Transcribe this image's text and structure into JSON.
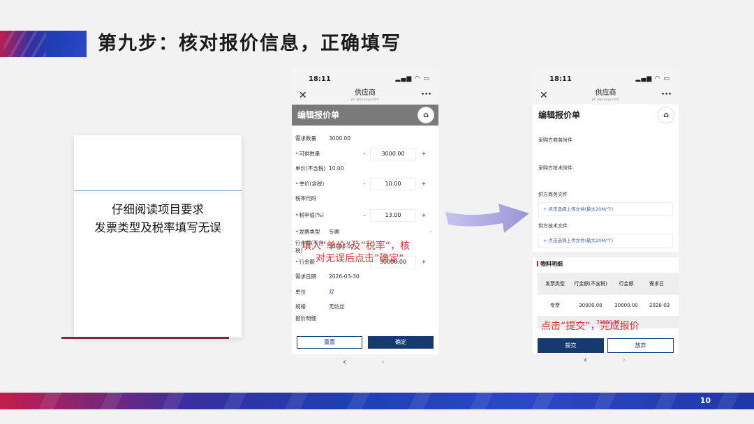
{
  "slide": {
    "title": "第九步：核对报价信息，正确填写",
    "note_lines": [
      "仔细阅读项目要求",
      "发票类型及税率填写无误"
    ],
    "annotation_left": [
      "填入”单价“及”税率“，核",
      "对无误后点击”确定“"
    ],
    "annotation_right": "点击“提交”，完成报价",
    "page_number": "10"
  },
  "phone_left": {
    "time": "18:11",
    "close": "✕",
    "title": "供应商",
    "url": "pc.wycxyyj.com",
    "more": "···",
    "header": "编辑报价单",
    "rows": [
      {
        "label": "需求数量",
        "value": "3000.00",
        "required": false
      },
      {
        "label": "可供数量",
        "value": "",
        "required": true,
        "stepper": "3000.00"
      },
      {
        "label": "单价(不含税)",
        "value": "10.00",
        "required": false
      },
      {
        "label": "单价(含税)",
        "value": "",
        "required": true,
        "stepper": "10.00"
      },
      {
        "label": "税率代码",
        "value": "",
        "required": false
      },
      {
        "label": "税率值(%)",
        "value": "",
        "required": true,
        "stepper": "13.00"
      },
      {
        "label": "发票类型",
        "value": "专票",
        "required": true
      },
      {
        "label": "行金额(不含税)",
        "value": "30000.00",
        "required": false
      },
      {
        "label": "行金额",
        "value": "",
        "required": true,
        "stepper": "30000.00"
      },
      {
        "label": "需求日期",
        "value": "2026-03-30",
        "required": false
      },
      {
        "label": "单位",
        "value": "双",
        "required": false
      },
      {
        "label": "规格",
        "value": "无纺丝",
        "required": false
      },
      {
        "label": "报价明细",
        "value": "",
        "required": false
      }
    ],
    "stepper_minus": "-",
    "stepper_plus": "+",
    "reset_label": "重置",
    "confirm_label": "确定",
    "back": "‹",
    "forward": "›"
  },
  "phone_right": {
    "time": "18:11",
    "close": "✕",
    "title": "供应商",
    "url": "pc.wycxyyj.com",
    "more": "···",
    "header": "编辑报价单",
    "buyer_business_files": "采购方商务附件",
    "buyer_tech_files": "采购方技术附件",
    "supplier_business_files": "供方商务文件",
    "supplier_tech_files": "供方技术文件",
    "upload_text": "+ 点击选择上传文件(最大20M/个)",
    "materials_title": "物料明细",
    "table_headers": [
      "发票类型",
      "行金额(不含税)",
      "行金额",
      "需求日"
    ],
    "table_row": [
      "专票",
      "30000.00",
      "30000.00",
      "2026-03"
    ],
    "total": "30000.00",
    "submit_label": "提交",
    "abandon_label": "放弃",
    "back": "‹",
    "forward": "›"
  }
}
